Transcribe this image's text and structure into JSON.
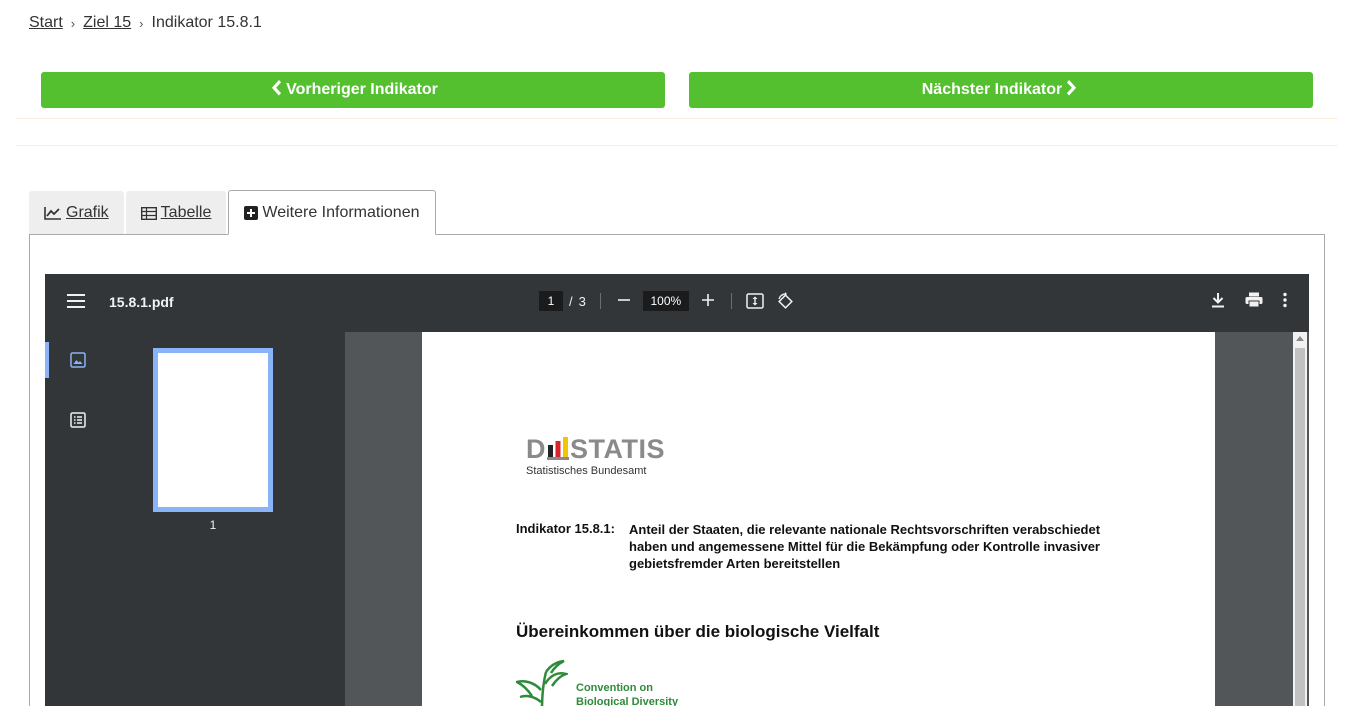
{
  "breadcrumb": {
    "items": [
      "Start",
      "Ziel 15"
    ],
    "current": "Indikator 15.8.1",
    "separator": "›"
  },
  "nav": {
    "prev_label": "Vorheriger Indikator",
    "next_label": "Nächster Indikator",
    "accent": "#55c02f"
  },
  "tabs": [
    {
      "label": "Grafik",
      "icon": "line-chart-icon"
    },
    {
      "label": "Tabelle",
      "icon": "table-icon"
    },
    {
      "label": "Weitere Informationen",
      "icon": "plus-square-icon",
      "active": true
    }
  ],
  "pdf_viewer": {
    "filename": "15.8.1.pdf",
    "page_current": "1",
    "page_separator": "/",
    "page_total": "3",
    "zoom": "100%",
    "thumbnail_page": "1"
  },
  "document": {
    "logo_word_left": "D",
    "logo_word_right": "STATIS",
    "logo_subtitle": "Statistisches Bundesamt",
    "indicator_label": "Indikator 15.8.1:",
    "indicator_text": "Anteil der Staaten, die relevante nationale Rechtsvorschriften verabschiedet haben und angemessene Mittel für die Bekämpfung oder Kontrolle invasiver gebietsfremder Arten bereitstellen",
    "section_title": "Übereinkommen über die biologische Vielfalt",
    "cbd_line1": "Convention on",
    "cbd_line2": "Biological Diversity"
  }
}
